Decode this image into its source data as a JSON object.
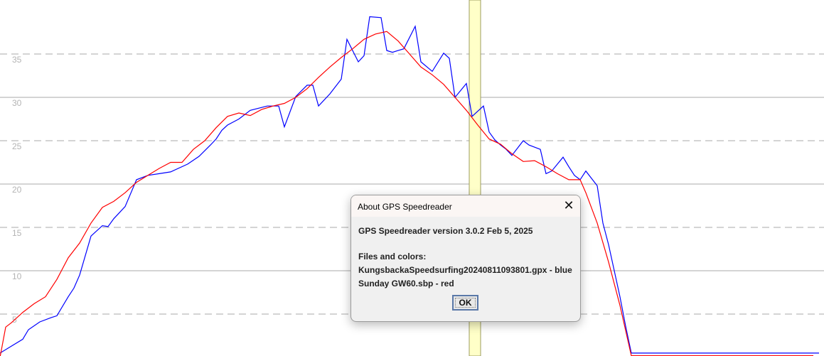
{
  "chart_data": {
    "type": "line",
    "ylim": [
      0,
      41
    ],
    "y_ticks": [
      "5",
      "10",
      "15",
      "20",
      "25",
      "30",
      "35"
    ],
    "highlight_x": 83.5,
    "series": [
      {
        "color": "#0000ff",
        "x": [
          0,
          2,
          4,
          5,
          7,
          9,
          10,
          12,
          13,
          14,
          16,
          18,
          19,
          20,
          22,
          24,
          26,
          28,
          30,
          33,
          35,
          37,
          38,
          39,
          40,
          42,
          44,
          47,
          49,
          50,
          52,
          54,
          55,
          56,
          58,
          60,
          61,
          63,
          64,
          65,
          67,
          68,
          69,
          70,
          71,
          73,
          74,
          76,
          78,
          79,
          80,
          82,
          83,
          85,
          86,
          87,
          88,
          89,
          90,
          92,
          93,
          95,
          96,
          97,
          99,
          100,
          101,
          102,
          103,
          105,
          106,
          107,
          108,
          109,
          110,
          111,
          112,
          114,
          116,
          117,
          118,
          119,
          121,
          122,
          123,
          124,
          125,
          126,
          127,
          128,
          129,
          130,
          131,
          132,
          133,
          134,
          135,
          136,
          137,
          138,
          139,
          140,
          141,
          142,
          143,
          144
        ],
        "y": [
          0.5,
          1.3,
          2.1,
          3.2,
          4.1,
          4.6,
          4.8,
          7.0,
          8.0,
          9.5,
          14.0,
          15.2,
          15.1,
          16.0,
          17.4,
          20.5,
          21.0,
          21.2,
          21.4,
          22.3,
          23.2,
          24.5,
          25.2,
          26.2,
          26.8,
          27.5,
          28.5,
          29.0,
          29.0,
          26.6,
          30.1,
          31.4,
          31.4,
          29.0,
          30.4,
          32.1,
          36.7,
          34.1,
          34.8,
          39.3,
          39.2,
          35.4,
          35.2,
          35.4,
          35.6,
          38.2,
          34.1,
          33.0,
          35.1,
          34.5,
          30.0,
          31.6,
          27.8,
          29.0,
          26.0,
          25.1,
          24.5,
          24.0,
          23.3,
          25.0,
          24.5,
          24.0,
          21.2,
          21.5,
          23.1,
          22.0,
          21.0,
          20.5,
          21.5,
          19.8,
          15.5,
          13.0,
          10.0,
          7.0,
          3.6,
          0.5,
          0.5,
          0.5,
          0.5,
          0.5,
          0.5,
          0.5,
          0.5,
          0.5,
          0.5,
          0.5,
          0.5,
          0.5,
          0.5,
          0.5,
          0.5,
          0.5,
          0.5,
          0.5,
          0.5,
          0.5,
          0.5,
          0.5,
          0.5,
          0.5,
          0.5,
          0.5,
          0.5,
          0.5,
          0.5,
          0.5
        ]
      },
      {
        "color": "#ff0000",
        "x": [
          0,
          1,
          2,
          4,
          6,
          8,
          10,
          12,
          14,
          16,
          18,
          20,
          22,
          24,
          26,
          28,
          30,
          32,
          34,
          36,
          38,
          40,
          42,
          44,
          46,
          48,
          50,
          52,
          54,
          56,
          58,
          60,
          62,
          64,
          66,
          68,
          70,
          72,
          74,
          76,
          78,
          80,
          82,
          84,
          86,
          88,
          90,
          92,
          94,
          96,
          98,
          100,
          102,
          103,
          105,
          107,
          109,
          111,
          113,
          115,
          117,
          119,
          121,
          123,
          125,
          127,
          129,
          131,
          133,
          135,
          137,
          139,
          141,
          143
        ],
        "y": [
          0,
          3.5,
          4.0,
          5.2,
          6.2,
          7.0,
          9.0,
          11.5,
          13.2,
          15.5,
          17.3,
          18.0,
          19.0,
          20.2,
          21.0,
          21.8,
          22.5,
          22.5,
          24.0,
          25.0,
          26.5,
          27.8,
          28.2,
          27.9,
          28.6,
          29.0,
          29.3,
          30.0,
          31.0,
          32.3,
          33.5,
          34.6,
          35.6,
          36.7,
          37.3,
          37.6,
          36.5,
          35.0,
          33.5,
          32.6,
          31.5,
          30.0,
          28.5,
          26.8,
          25.2,
          24.6,
          23.5,
          22.6,
          22.7,
          22.0,
          21.2,
          20.5,
          20.5,
          19.0,
          15.5,
          11.0,
          6.0,
          0.2,
          0.2,
          0.2,
          0.2,
          0.2,
          0.2,
          0.2,
          0.2,
          0.2,
          0.2,
          0.2,
          0.2,
          0.2,
          0.2,
          0.2,
          0.2,
          0.2
        ]
      }
    ]
  },
  "dialog": {
    "title": "About GPS Speedreader",
    "close_glyph": "✕",
    "version_line": "GPS Speedreader version 3.0.2 Feb 5, 2025",
    "files_heading": "Files and colors:",
    "file1": "KungsbackaSpeedsurfing20240811093801.gpx - blue",
    "file2": "Sunday GW60.sbp - red",
    "ok_label": "OK"
  }
}
